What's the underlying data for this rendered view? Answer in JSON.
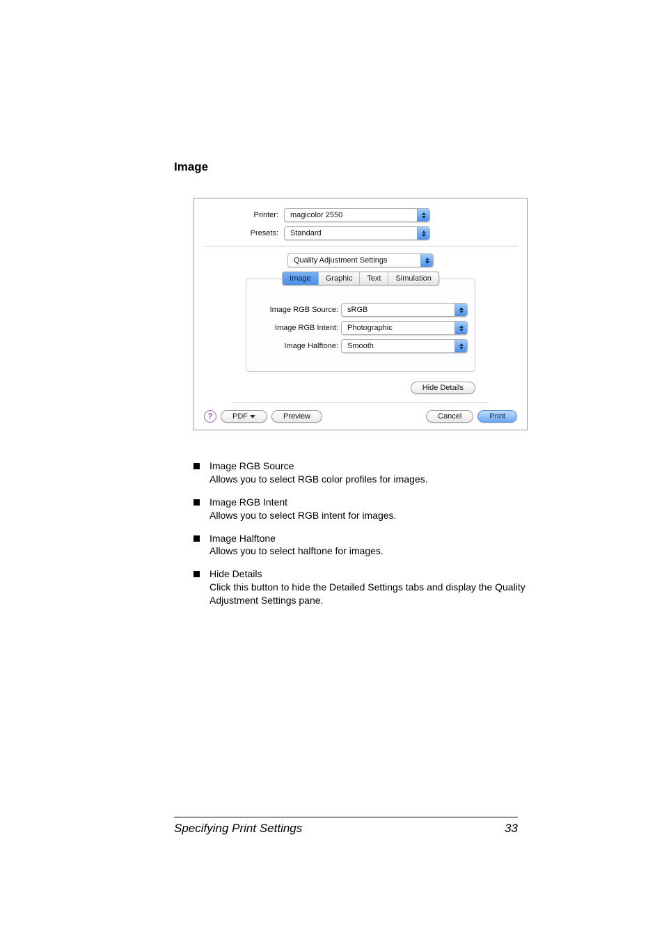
{
  "section_title": "Image",
  "dialog": {
    "printer_label": "Printer:",
    "printer_value": "magicolor 2550",
    "presets_label": "Presets:",
    "presets_value": "Standard",
    "pane_value": "Quality Adjustment Settings",
    "tabs": {
      "image": "Image",
      "graphic": "Graphic",
      "text": "Text",
      "simulation": "Simulation"
    },
    "fields": {
      "rgb_source_label": "Image RGB Source:",
      "rgb_source_value": "sRGB",
      "rgb_intent_label": "Image RGB Intent:",
      "rgb_intent_value": "Photographic",
      "halftone_label": "Image Halftone:",
      "halftone_value": "Smooth"
    },
    "hide_details": "Hide Details",
    "help": "?",
    "pdf": "PDF",
    "preview": "Preview",
    "cancel": "Cancel",
    "print": "Print"
  },
  "bullets": [
    {
      "head": "Image RGB Source",
      "body": "Allows you to select RGB color profiles for images."
    },
    {
      "head": "Image RGB Intent",
      "body": "Allows you to select RGB intent for images."
    },
    {
      "head": "Image Halftone",
      "body": "Allows you to select halftone for images."
    },
    {
      "head": "Hide Details",
      "body": "Click this button to hide the Detailed Settings tabs and display the Quality Adjustment Settings pane."
    }
  ],
  "footer": {
    "title": "Specifying Print Settings",
    "page": "33"
  }
}
